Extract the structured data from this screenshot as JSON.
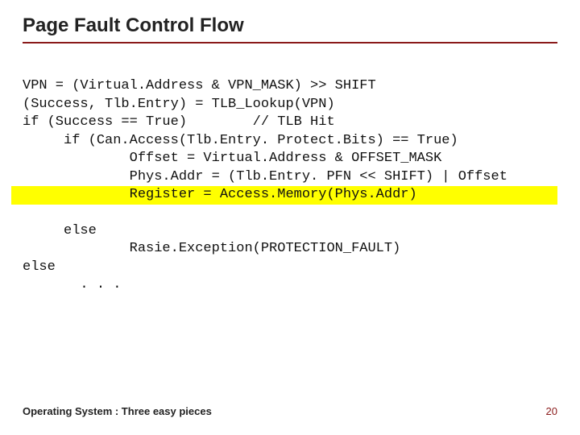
{
  "title": "Page Fault Control Flow",
  "code": {
    "l1": "VPN = (Virtual.Address & VPN_MASK) >> SHIFT",
    "l2": "(Success, Tlb.Entry) = TLB_Lookup(VPN)",
    "l3": "if (Success == True)        // TLB Hit",
    "l4": "     if (Can.Access(Tlb.Entry. Protect.Bits) == True)",
    "l5": "             Offset = Virtual.Address & OFFSET_MASK",
    "l6": "             Phys.Addr = (Tlb.Entry. PFN << SHIFT) | Offset",
    "l7": "             Register = Access.Memory(Phys.Addr)",
    "l8": "     else",
    "l9": "             Rasie.Exception(PROTECTION_FAULT)",
    "l10": "else",
    "l11": "       . . ."
  },
  "footer": "Operating System : Three easy pieces",
  "page_number": "20"
}
